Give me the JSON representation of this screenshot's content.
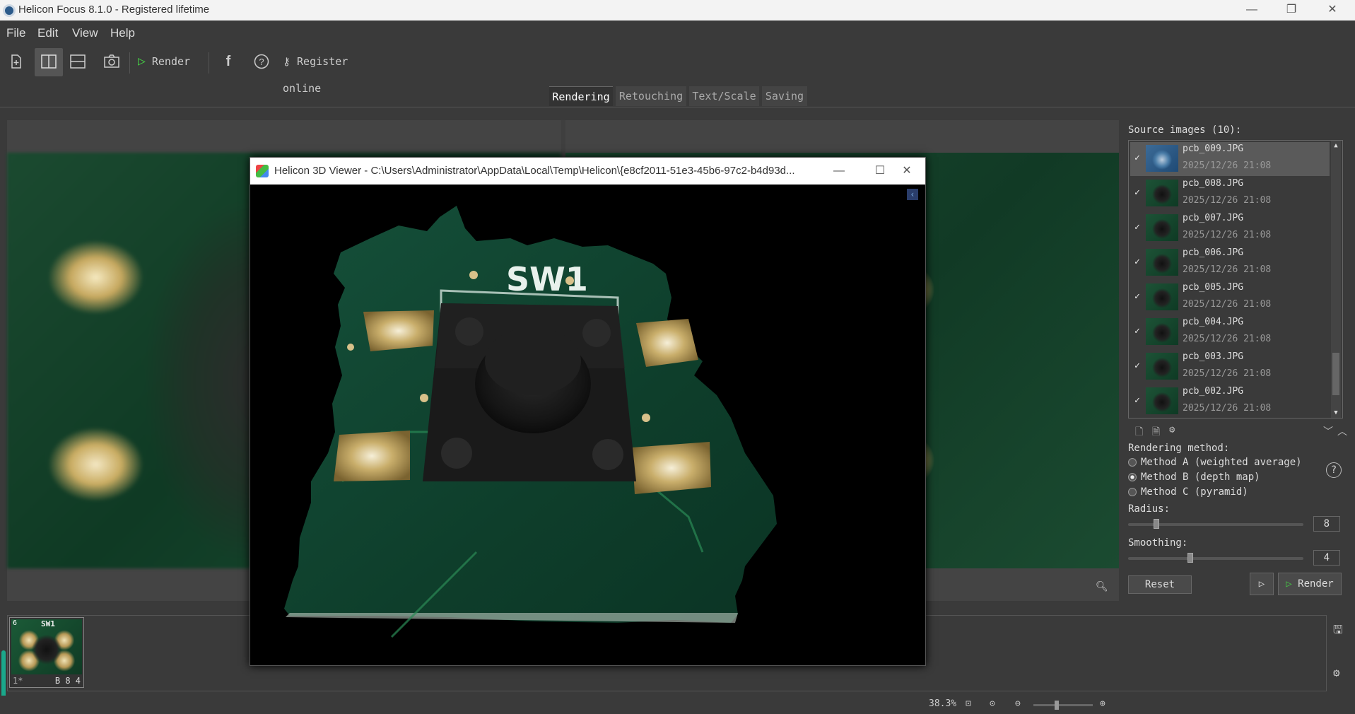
{
  "window": {
    "title": "Helicon Focus 8.1.0 - Registered  lifetime",
    "controls": [
      "minimize",
      "restore",
      "close"
    ]
  },
  "menu": [
    "File",
    "Edit",
    "View",
    "Help"
  ],
  "toolbar": {
    "render_label": "Render",
    "register_label": "Register online"
  },
  "tabs": [
    {
      "label": "Rendering",
      "active": true
    },
    {
      "label": "Retouching",
      "active": false
    },
    {
      "label": "Text/Scale",
      "active": false
    },
    {
      "label": "Saving",
      "active": false
    }
  ],
  "source_panel": {
    "label": "Source images (10):",
    "items": [
      {
        "name": "pcb_009.JPG",
        "date": "2025/12/26 21:08",
        "checked": true,
        "selected": true
      },
      {
        "name": "pcb_008.JPG",
        "date": "2025/12/26 21:08",
        "checked": true
      },
      {
        "name": "pcb_007.JPG",
        "date": "2025/12/26 21:08",
        "checked": true
      },
      {
        "name": "pcb_006.JPG",
        "date": "2025/12/26 21:08",
        "checked": true
      },
      {
        "name": "pcb_005.JPG",
        "date": "2025/12/26 21:08",
        "checked": true
      },
      {
        "name": "pcb_004.JPG",
        "date": "2025/12/26 21:08",
        "checked": true
      },
      {
        "name": "pcb_003.JPG",
        "date": "2025/12/26 21:08",
        "checked": true
      },
      {
        "name": "pcb_002.JPG",
        "date": "2025/12/26 21:08",
        "checked": true
      }
    ]
  },
  "rendering": {
    "method_label": "Rendering method:",
    "methods": [
      {
        "label": "Method A (weighted average)",
        "selected": false
      },
      {
        "label": "Method B (depth map)",
        "selected": true
      },
      {
        "label": "Method C (pyramid)",
        "selected": false
      }
    ],
    "radius_label": "Radius:",
    "radius_value": "8",
    "smoothing_label": "Smoothing:",
    "smoothing_value": "4",
    "reset_label": "Reset",
    "render_label": "Render"
  },
  "filmstrip": {
    "thumb_label": "1*",
    "thumb_method": "B 8 4",
    "thumb_number": "6",
    "thumb_text": "SW1"
  },
  "status": {
    "zoom": "38.3%"
  },
  "viewer": {
    "title": "Helicon 3D Viewer - C:\\Users\\Administrator\\AppData\\Local\\Temp\\Helicon\\{e8cf2011-51e3-45b6-97c2-b4d93d...",
    "silkscreen": "SW1"
  },
  "icons": {
    "check": "✓",
    "close": "✕",
    "minimize": "—",
    "maximize": "☐"
  }
}
